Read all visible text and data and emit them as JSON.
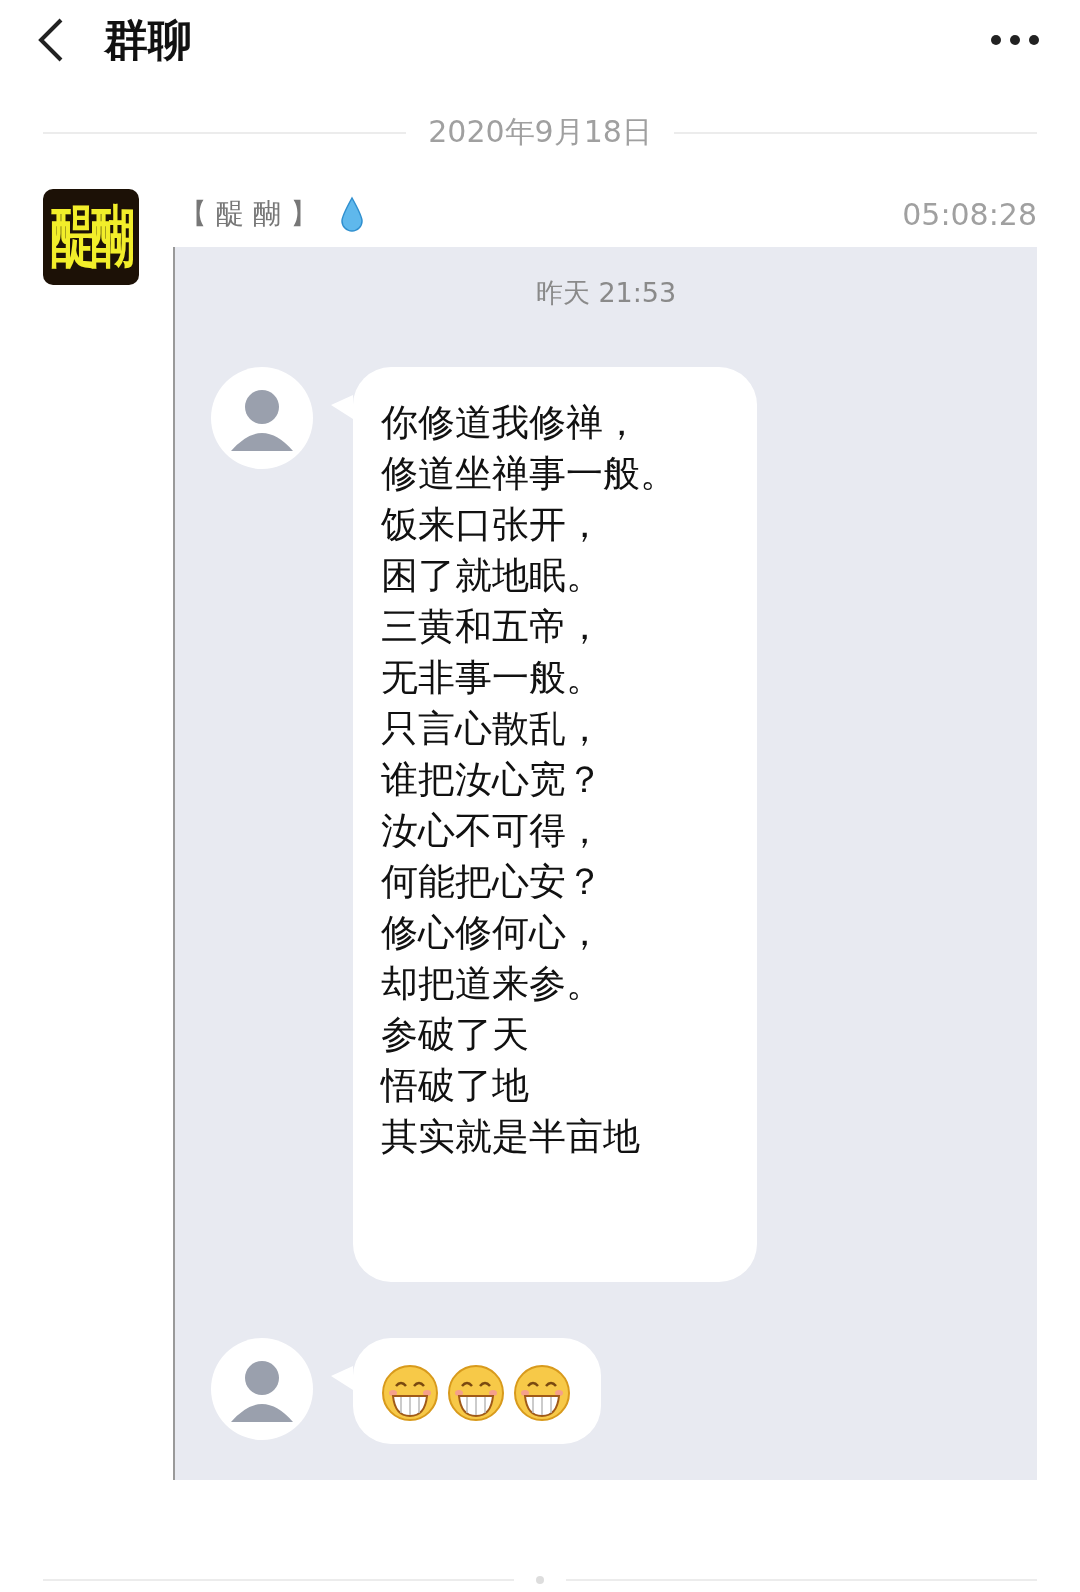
{
  "header": {
    "title": "群聊"
  },
  "date_divider": "2020年9月18日",
  "message": {
    "avatar_text": "醍醐",
    "sender": "【 醍 醐 】",
    "time": "05:08:28",
    "forwarded": {
      "time": "昨天 21:53",
      "items": [
        {
          "kind": "text",
          "lines": [
            "你修道我修禅，",
            "修道坐禅事一般。",
            "饭来口张开，",
            "困了就地眠。",
            "三黄和五帝，",
            "无非事一般。",
            "只言心散乱，",
            "谁把汝心宽？",
            "汝心不可得，",
            "何能把心安？",
            "修心修何心，",
            "却把道来参。",
            "参破了天",
            "悟破了地",
            "其实就是半亩地"
          ]
        },
        {
          "kind": "emoji",
          "emojis": [
            {
              "kind": "grin"
            },
            {
              "kind": "grin"
            },
            {
              "kind": "grin"
            }
          ]
        }
      ]
    }
  }
}
